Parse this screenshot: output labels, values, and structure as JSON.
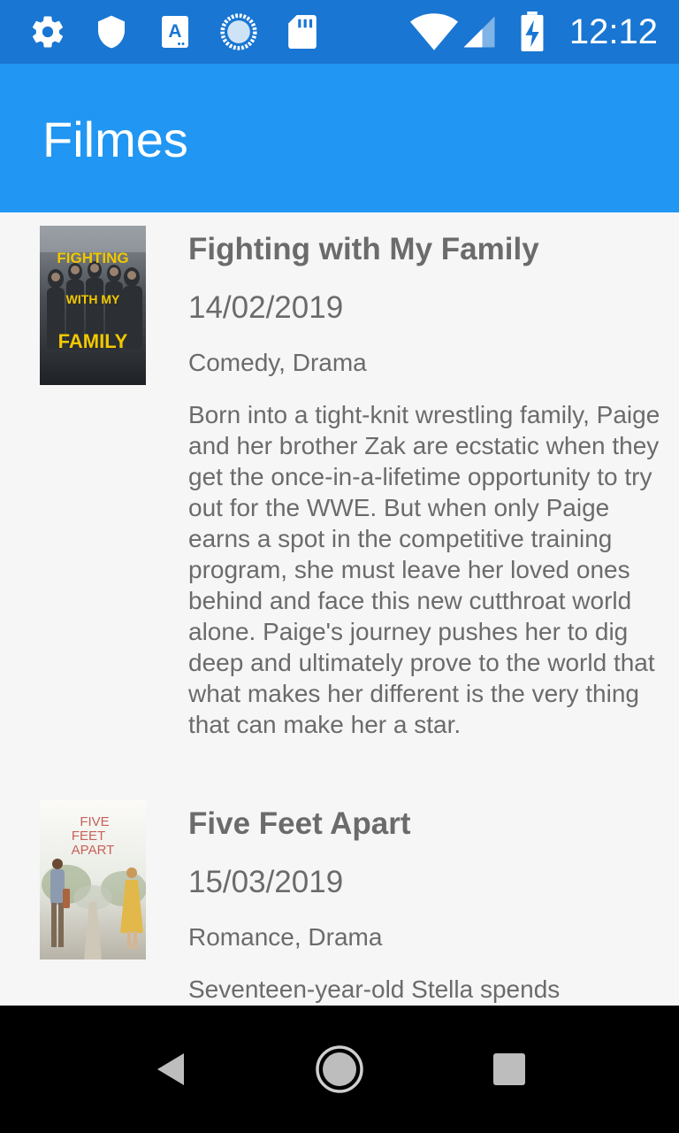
{
  "status_bar": {
    "time": "12:12",
    "icons": [
      "gear-icon",
      "shield-icon",
      "keyboard-a-icon",
      "sync-circle-icon",
      "sd-card-icon",
      "wifi-icon",
      "signal-icon",
      "battery-charging-icon"
    ]
  },
  "app_bar": {
    "title": "Filmes"
  },
  "movies": [
    {
      "title": "Fighting with My Family",
      "date": "14/02/2019",
      "genres": "Comedy, Drama",
      "overview": "Born into a tight-knit wrestling family, Paige and her brother Zak are ecstatic when they get the once-in-a-lifetime opportunity to try out for the WWE. But when only Paige earns a spot in the competitive training program, she must leave her loved ones behind and face this new cutthroat world alone. Paige's journey pushes her to dig deep and ultimately prove to the world that what makes her different is the very thing that can make her a star.",
      "poster_text": [
        "FIGHTING",
        "WITH MY",
        "FAMILY"
      ]
    },
    {
      "title": "Five Feet Apart",
      "date": "15/03/2019",
      "genres": "Romance, Drama",
      "overview": "Seventeen-year-old Stella spends",
      "poster_text": [
        "FIVE",
        "FEET",
        "APART"
      ]
    }
  ],
  "nav_bar": {
    "icons": [
      "back-icon",
      "home-icon",
      "recents-icon"
    ]
  },
  "colors": {
    "status_bar": "#1976d2",
    "app_bar": "#2196f3",
    "text": "#6b6b6b",
    "background": "#f6f6f6"
  }
}
